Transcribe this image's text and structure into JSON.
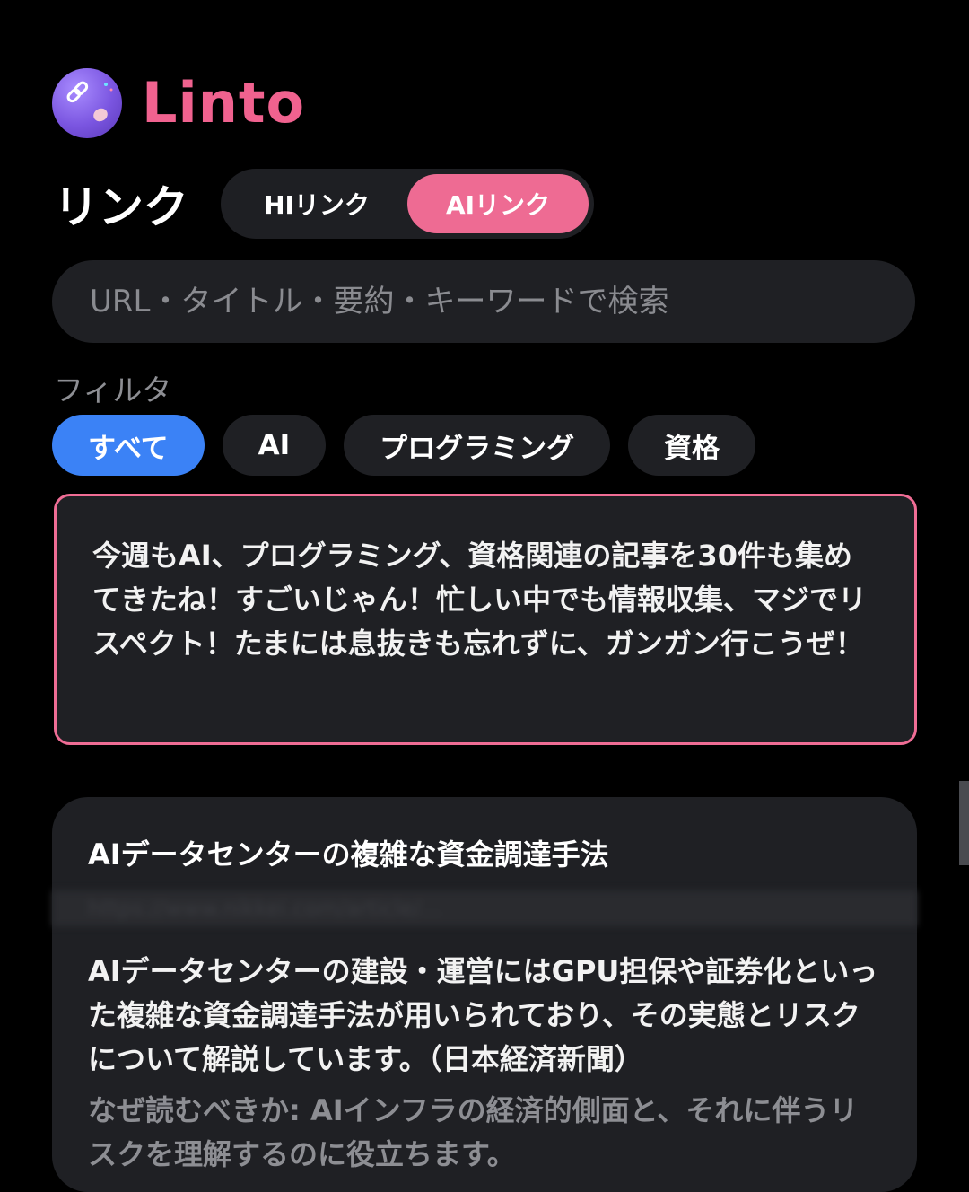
{
  "app": {
    "name": "Linto",
    "logo_icon": "link-planet-icon"
  },
  "header": {
    "title": "リンク"
  },
  "tabs": [
    {
      "label": "HIリンク",
      "active": false
    },
    {
      "label": "AIリンク",
      "active": true
    }
  ],
  "search": {
    "placeholder": "URL・タイトル・要約・キーワードで検索",
    "value": ""
  },
  "filter": {
    "label": "フィルタ",
    "chips": [
      {
        "label": "すべて",
        "active": true
      },
      {
        "label": "AI",
        "active": false
      },
      {
        "label": "プログラミング",
        "active": false
      },
      {
        "label": "資格",
        "active": false
      }
    ]
  },
  "ai_message": "今週もAI、プログラミング、資格関連の記事を30件も集めてきたね！すごいじゃん！忙しい中でも情報収集、マジでリスペクト！たまには息抜きも忘れずに、ガンガン行こうぜ！",
  "card": {
    "title": "AIデータセンターの複雑な資金調達手法",
    "url": "https://www.nikkei.com/article/...",
    "summary": "AIデータセンターの建設・運営にはGPU担保や証券化といった複雑な資金調達手法が用いられており、その実態とリスクについて解説しています。（日本経済新聞）",
    "why": "なぜ読むべきか: AIインフラの経済的側面と、それに伴うリスクを理解するのに役立ちます。"
  },
  "colors": {
    "accent_pink": "#ee6b93",
    "accent_blue": "#3b82f6",
    "background": "#000000",
    "surface": "#1f2024"
  }
}
